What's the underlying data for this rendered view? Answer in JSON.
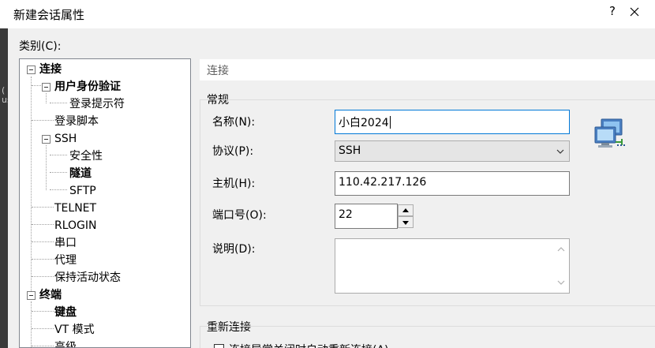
{
  "window": {
    "title": "新建会话属性",
    "help_label": "?"
  },
  "background": {
    "glyphs": [
      "(",
      "us"
    ]
  },
  "category": {
    "label": "类别(C):"
  },
  "tree": {
    "items": [
      {
        "label": "连接",
        "bold": true
      },
      {
        "label": "用户身份验证",
        "bold": true
      },
      {
        "label": "登录提示符",
        "bold": false
      },
      {
        "label": "登录脚本",
        "bold": false
      },
      {
        "label": "SSH",
        "bold": false
      },
      {
        "label": "安全性",
        "bold": false
      },
      {
        "label": "隧道",
        "bold": true
      },
      {
        "label": "SFTP",
        "bold": false
      },
      {
        "label": "TELNET",
        "bold": false
      },
      {
        "label": "RLOGIN",
        "bold": false
      },
      {
        "label": "串口",
        "bold": false
      },
      {
        "label": "代理",
        "bold": false
      },
      {
        "label": "保持活动状态",
        "bold": false
      },
      {
        "label": "终端",
        "bold": true
      },
      {
        "label": "键盘",
        "bold": true
      },
      {
        "label": "VT 模式",
        "bold": false
      },
      {
        "label": "高级",
        "bold": false
      }
    ]
  },
  "panel": {
    "header": "连接",
    "general": {
      "title": "常规",
      "name_label": "名称(N):",
      "name_value": "小白2024",
      "protocol_label": "协议(P):",
      "protocol_value": "SSH",
      "host_label": "主机(H):",
      "host_value": "110.42.217.126",
      "port_label": "端口号(O):",
      "port_value": "22",
      "desc_label": "说明(D):",
      "desc_value": ""
    },
    "reconnect": {
      "title": "重新连接",
      "checkbox_label": "连接异常关闭时自动重新连接(A)"
    }
  },
  "icons": {
    "close": "close-icon",
    "network": "network-computer-icon",
    "dropdown": "chevron-down-icon"
  },
  "colors": {
    "dialog_bg": "#f0f0f0",
    "focus_border": "#0078d7",
    "combo_bg": "#e5e5e5"
  }
}
